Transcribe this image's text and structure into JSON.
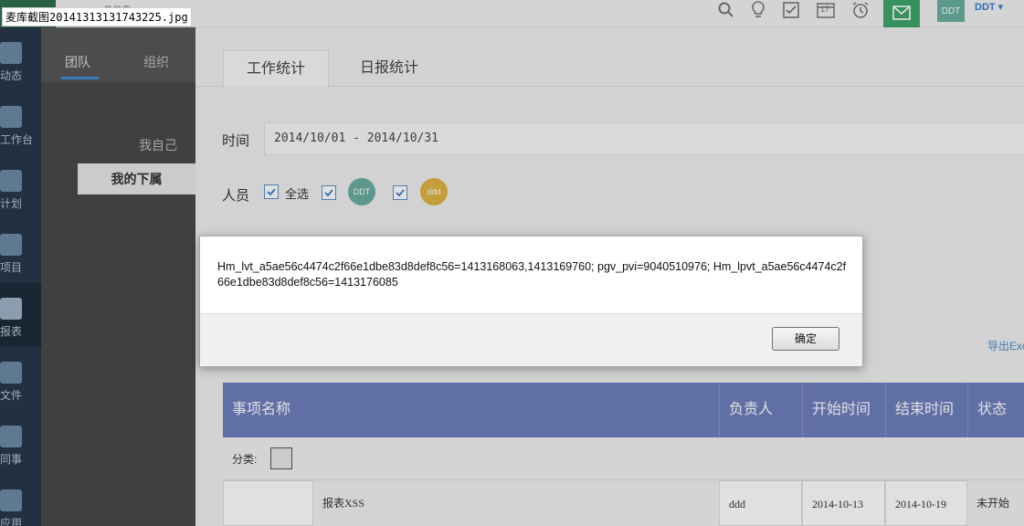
{
  "file_tag": "麦库截图20141313131743225.jpg",
  "topbar": {
    "app_name": "DDT",
    "user_avatar": "DDT",
    "user_name": "DDT",
    "icons": [
      "search-icon",
      "lightbulb-icon",
      "checkbox-icon",
      "calendar-icon",
      "alarm-icon",
      "mail-icon"
    ],
    "calendar_day": "17"
  },
  "leftnav": {
    "items": [
      {
        "label": "动态",
        "icon": "chat-icon"
      },
      {
        "label": "工作台",
        "icon": "monitor-icon"
      },
      {
        "label": "计划",
        "icon": "plan-icon"
      },
      {
        "label": "项目",
        "icon": "project-icon"
      },
      {
        "label": "报表",
        "icon": "report-icon",
        "active": true
      },
      {
        "label": "文件",
        "icon": "file-icon"
      },
      {
        "label": "同事",
        "icon": "people-icon"
      },
      {
        "label": "应用",
        "icon": "apps-icon"
      }
    ]
  },
  "subpanel": {
    "tabs": [
      "团队",
      "组织"
    ],
    "items": [
      "我自己",
      "我的下属"
    ]
  },
  "main": {
    "tabs": [
      "工作统计",
      "日报统计"
    ],
    "time_label": "时间",
    "time_value": "2014/10/01 - 2014/10/31",
    "people_label": "人员",
    "select_all": "全选",
    "person1": "DDT",
    "person2": "ddd",
    "export": "导出Exc"
  },
  "table": {
    "headers": [
      "事项名称",
      "负责人",
      "开始时间",
      "结束时间",
      "状态"
    ],
    "filter_label": "分类:",
    "rows": [
      {
        "name": "报表XSS",
        "owner": "ddd",
        "start": "2014-10-13",
        "end": "2014-10-19",
        "status": "未开始"
      }
    ]
  },
  "dialog": {
    "message": "Hm_lvt_a5ae56c4474c2f66e1dbe83d8def8c56=1413168063,1413169760; pgv_pvi=9040510976; Hm_lpvt_a5ae56c4474c2f66e1dbe83d8def8c56=1413176085",
    "ok_label": "确定"
  },
  "colors": {
    "nav_bg": "#26384a",
    "subpanel_bg": "#494949",
    "table_header": "#6f7fbf",
    "accent_green": "#3ea66b",
    "avatar_ddt": "#6aaea0",
    "avatar_ddd": "#e0b443"
  }
}
